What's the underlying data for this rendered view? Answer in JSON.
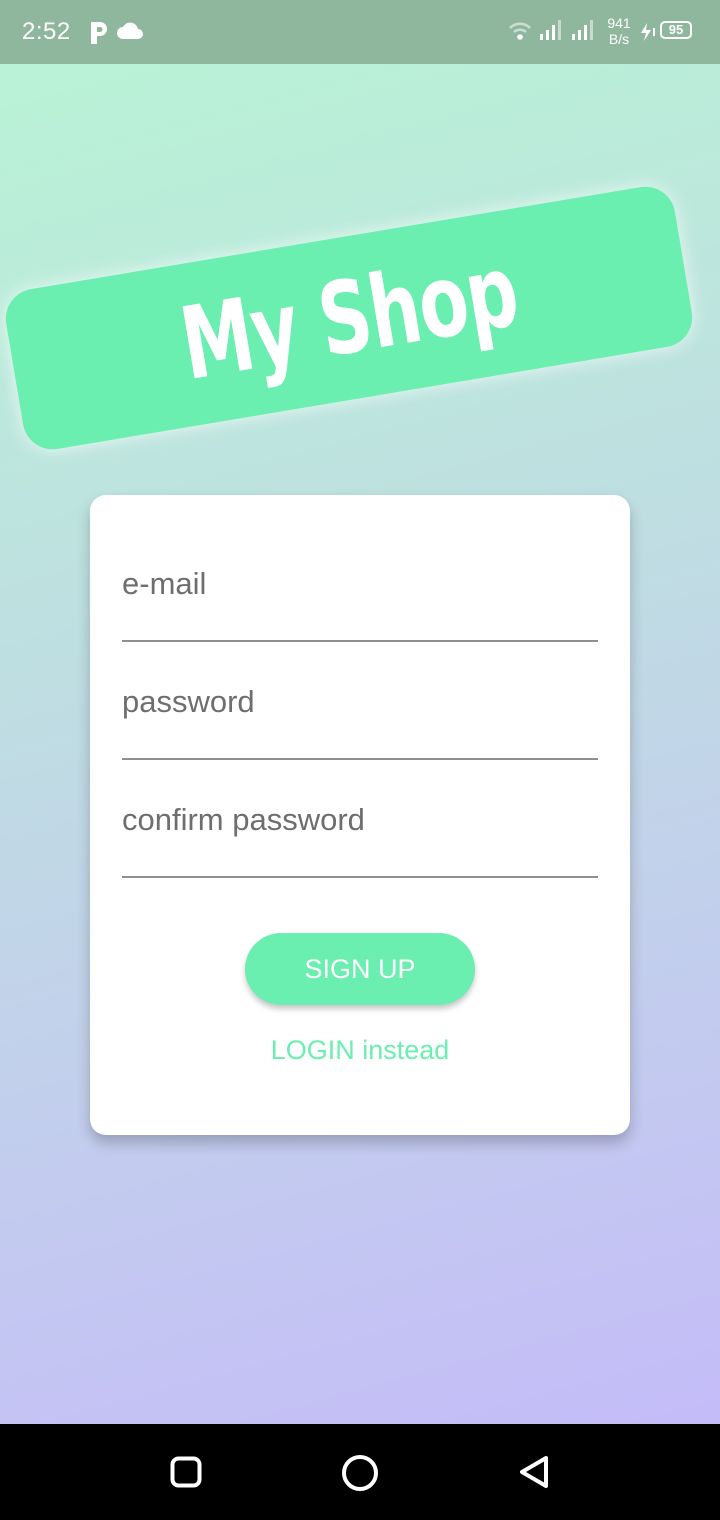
{
  "status_bar": {
    "time": "2:52",
    "network_speed_value": "941",
    "network_speed_unit": "B/s",
    "battery": "95",
    "icons": [
      "p-icon",
      "cloud-icon",
      "wifi-icon",
      "signal-icon",
      "signal-icon",
      "charging-icon"
    ]
  },
  "banner": {
    "title": "My Shop"
  },
  "form": {
    "email_placeholder": "e-mail",
    "password_placeholder": "password",
    "confirm_placeholder": "confirm password",
    "signup_label": "SIGN UP",
    "login_label": "LOGIN instead"
  },
  "nav_bar": {
    "icons": [
      "recent-apps-icon",
      "home-icon",
      "back-icon"
    ]
  },
  "colors": {
    "accent": "#6aefb0",
    "status_bar": "#8fb79d",
    "card": "#ffffff",
    "nav_bar": "#000000"
  }
}
